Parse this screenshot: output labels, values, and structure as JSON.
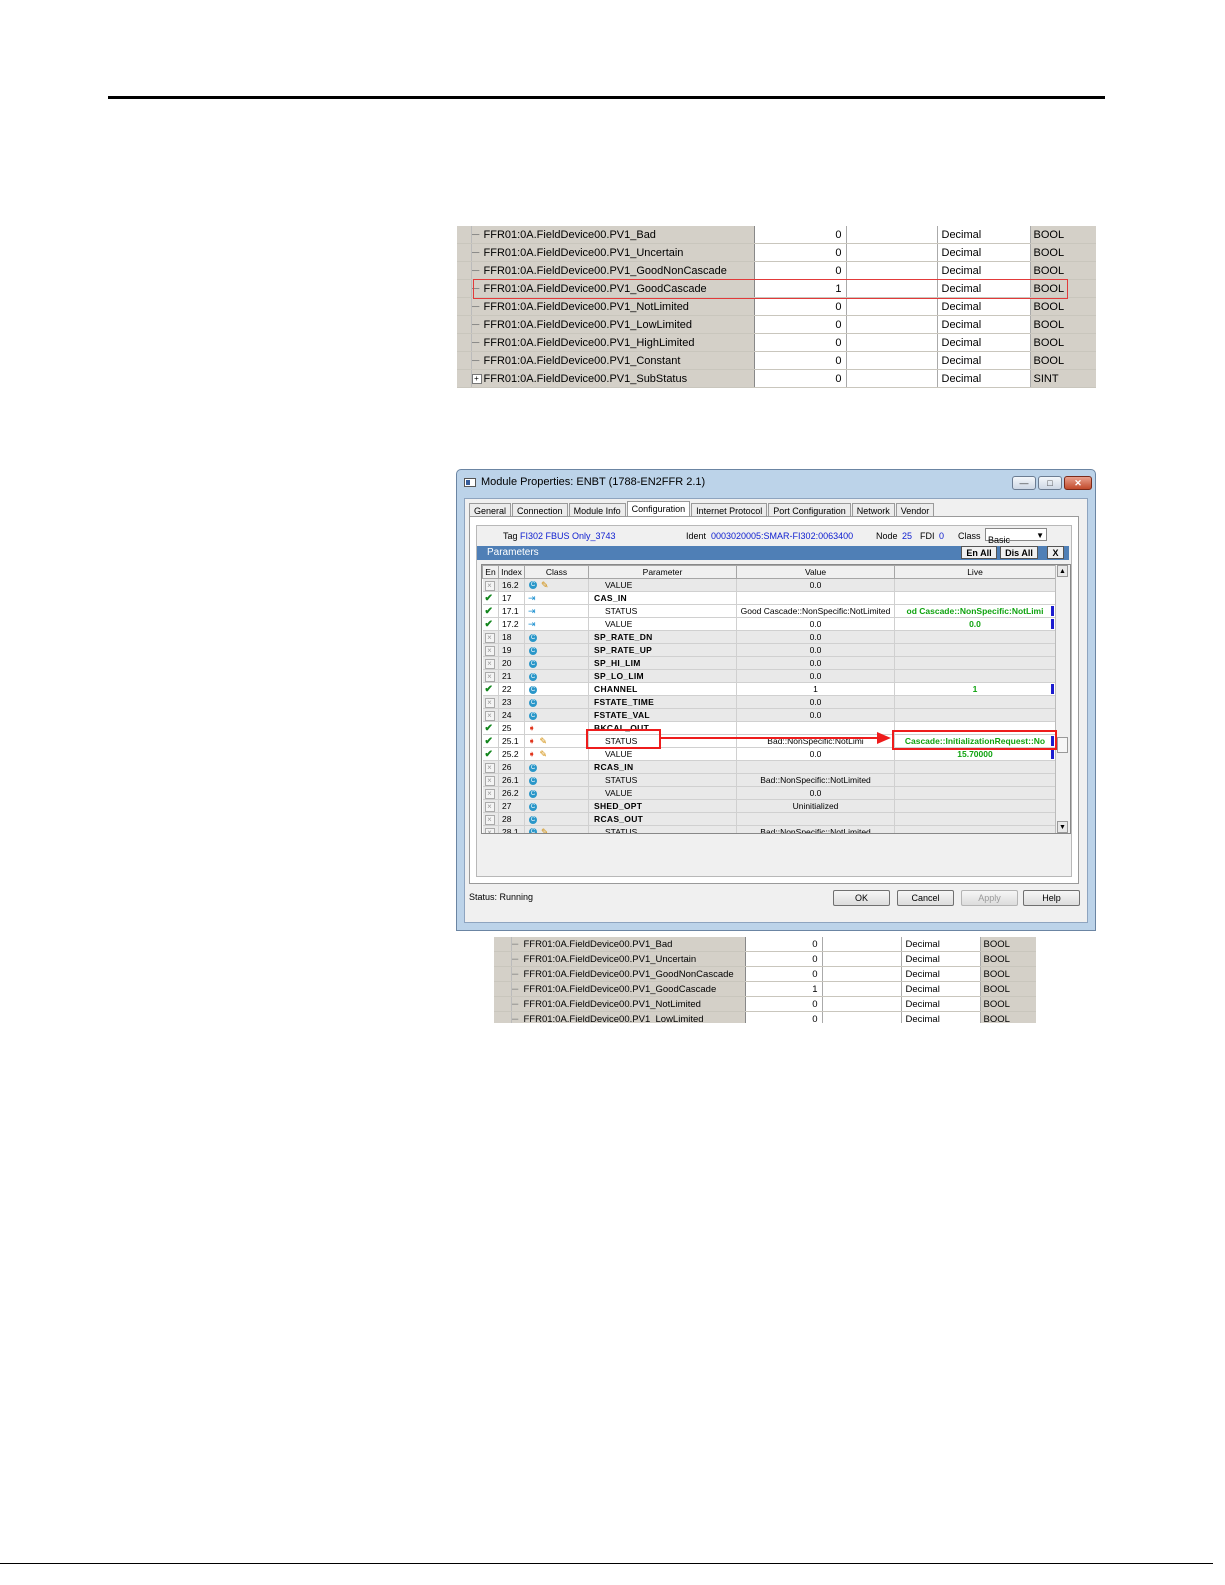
{
  "top_grid": {
    "rows": [
      {
        "name": "FFR01:0A.FieldDevice00.PV1_Bad",
        "value": "0",
        "style": "Decimal",
        "type": "BOOL",
        "expandable": false
      },
      {
        "name": "FFR01:0A.FieldDevice00.PV1_Uncertain",
        "value": "0",
        "style": "Decimal",
        "type": "BOOL",
        "expandable": false
      },
      {
        "name": "FFR01:0A.FieldDevice00.PV1_GoodNonCascade",
        "value": "0",
        "style": "Decimal",
        "type": "BOOL",
        "expandable": false
      },
      {
        "name": "FFR01:0A.FieldDevice00.PV1_GoodCascade",
        "value": "1",
        "style": "Decimal",
        "type": "BOOL",
        "expandable": false
      },
      {
        "name": "FFR01:0A.FieldDevice00.PV1_NotLimited",
        "value": "0",
        "style": "Decimal",
        "type": "BOOL",
        "expandable": false
      },
      {
        "name": "FFR01:0A.FieldDevice00.PV1_LowLimited",
        "value": "0",
        "style": "Decimal",
        "type": "BOOL",
        "expandable": false
      },
      {
        "name": "FFR01:0A.FieldDevice00.PV1_HighLimited",
        "value": "0",
        "style": "Decimal",
        "type": "BOOL",
        "expandable": false
      },
      {
        "name": "FFR01:0A.FieldDevice00.PV1_Constant",
        "value": "0",
        "style": "Decimal",
        "type": "BOOL",
        "expandable": false
      },
      {
        "name": "FFR01:0A.FieldDevice00.PV1_SubStatus",
        "value": "0",
        "style": "Decimal",
        "type": "SINT",
        "expandable": true
      }
    ]
  },
  "dialog": {
    "title": "Module Properties: ENBT (1788-EN2FFR 2.1)",
    "tabs": [
      "General",
      "Connection",
      "Module Info",
      "Configuration",
      "Internet Protocol",
      "Port Configuration",
      "Network",
      "Vendor"
    ],
    "active_tab": "Configuration",
    "info": {
      "tag_label": "Tag",
      "tag_value": "FI302 FBUS Only_3743",
      "ident_label": "Ident",
      "ident_value": "0003020005:SMAR-FI302:0063400",
      "node_label": "Node",
      "node_value": "25",
      "fdi_label": "FDI",
      "fdi_value": "0",
      "class_label": "Class",
      "class_value": "Basic"
    },
    "params_title": "Parameters",
    "en_all": "En All",
    "dis_all": "Dis All",
    "close_x": "X",
    "columns": [
      "En",
      "Index",
      "Class",
      "Parameter",
      "Value",
      "Live"
    ],
    "rows": [
      {
        "en": "x",
        "index": "16.2",
        "cls": "c",
        "pen": true,
        "param": "VALUE",
        "sub": true,
        "bold": false,
        "value": "0.0",
        "live": "",
        "mark": false
      },
      {
        "en": "check",
        "index": "17",
        "cls": "in",
        "pen": false,
        "param": "CAS_IN",
        "sub": false,
        "bold": true,
        "value": "",
        "live": "",
        "mark": false
      },
      {
        "en": "check",
        "index": "17.1",
        "cls": "in",
        "pen": false,
        "param": "STATUS",
        "sub": true,
        "bold": false,
        "value": "Good Cascade::NonSpecific:NotLimited",
        "live": "od Cascade::NonSpecific:NotLimi",
        "mark": true
      },
      {
        "en": "check",
        "index": "17.2",
        "cls": "in",
        "pen": false,
        "param": "VALUE",
        "sub": true,
        "bold": false,
        "value": "0.0",
        "live": "0.0",
        "mark": true
      },
      {
        "en": "x",
        "index": "18",
        "cls": "c",
        "pen": false,
        "param": "SP_RATE_DN",
        "sub": false,
        "bold": true,
        "value": "0.0",
        "live": "",
        "mark": false
      },
      {
        "en": "x",
        "index": "19",
        "cls": "c",
        "pen": false,
        "param": "SP_RATE_UP",
        "sub": false,
        "bold": true,
        "value": "0.0",
        "live": "",
        "mark": false
      },
      {
        "en": "x",
        "index": "20",
        "cls": "c",
        "pen": false,
        "param": "SP_HI_LIM",
        "sub": false,
        "bold": true,
        "value": "0.0",
        "live": "",
        "mark": false
      },
      {
        "en": "x",
        "index": "21",
        "cls": "c",
        "pen": false,
        "param": "SP_LO_LIM",
        "sub": false,
        "bold": true,
        "value": "0.0",
        "live": "",
        "mark": false
      },
      {
        "en": "check",
        "index": "22",
        "cls": "c",
        "pen": false,
        "param": "CHANNEL",
        "sub": false,
        "bold": true,
        "value": "1",
        "live": "1",
        "mark": true
      },
      {
        "en": "x",
        "index": "23",
        "cls": "c",
        "pen": false,
        "param": "FSTATE_TIME",
        "sub": false,
        "bold": true,
        "value": "0.0",
        "live": "",
        "mark": false
      },
      {
        "en": "x",
        "index": "24",
        "cls": "c",
        "pen": false,
        "param": "FSTATE_VAL",
        "sub": false,
        "bold": true,
        "value": "0.0",
        "live": "",
        "mark": false
      },
      {
        "en": "check",
        "index": "25",
        "cls": "out",
        "pen": false,
        "param": "BKCAL_OUT",
        "sub": false,
        "bold": true,
        "value": "",
        "live": "",
        "mark": false
      },
      {
        "en": "check",
        "index": "25.1",
        "cls": "out",
        "pen": true,
        "param": "STATUS",
        "sub": true,
        "bold": false,
        "value": "Bad::NonSpecific:NotLimi",
        "live": "Cascade::InitializationRequest::No",
        "mark": true
      },
      {
        "en": "check",
        "index": "25.2",
        "cls": "out",
        "pen": true,
        "param": "VALUE",
        "sub": true,
        "bold": false,
        "value": "0.0",
        "live": "15.70000",
        "mark": true
      },
      {
        "en": "x",
        "index": "26",
        "cls": "c",
        "pen": false,
        "param": "RCAS_IN",
        "sub": false,
        "bold": true,
        "value": "",
        "live": "",
        "mark": false
      },
      {
        "en": "x",
        "index": "26.1",
        "cls": "c",
        "pen": false,
        "param": "STATUS",
        "sub": true,
        "bold": false,
        "value": "Bad::NonSpecific::NotLimited",
        "live": "",
        "mark": false
      },
      {
        "en": "x",
        "index": "26.2",
        "cls": "c",
        "pen": false,
        "param": "VALUE",
        "sub": true,
        "bold": false,
        "value": "0.0",
        "live": "",
        "mark": false
      },
      {
        "en": "x",
        "index": "27",
        "cls": "c",
        "pen": false,
        "param": "SHED_OPT",
        "sub": false,
        "bold": true,
        "value": "Uninitialized",
        "live": "",
        "mark": false
      },
      {
        "en": "x",
        "index": "28",
        "cls": "c",
        "pen": false,
        "param": "RCAS_OUT",
        "sub": false,
        "bold": true,
        "value": "",
        "live": "",
        "mark": false
      },
      {
        "en": "x",
        "index": "28.1",
        "cls": "c",
        "pen": true,
        "param": "STATUS",
        "sub": true,
        "bold": false,
        "value": "Bad::NonSpecific::NotLimited",
        "live": "",
        "mark": false
      }
    ],
    "status_label": "Status:",
    "status_value": "Running",
    "buttons": {
      "ok": "OK",
      "cancel": "Cancel",
      "apply": "Apply",
      "help": "Help"
    }
  },
  "bottom_grid": {
    "rows": [
      {
        "name": "FFR01:0A.FieldDevice00.PV1_Bad",
        "value": "0",
        "style": "Decimal",
        "type": "BOOL"
      },
      {
        "name": "FFR01:0A.FieldDevice00.PV1_Uncertain",
        "value": "0",
        "style": "Decimal",
        "type": "BOOL"
      },
      {
        "name": "FFR01:0A.FieldDevice00.PV1_GoodNonCascade",
        "value": "0",
        "style": "Decimal",
        "type": "BOOL"
      },
      {
        "name": "FFR01:0A.FieldDevice00.PV1_GoodCascade",
        "value": "1",
        "style": "Decimal",
        "type": "BOOL"
      },
      {
        "name": "FFR01:0A.FieldDevice00.PV1_NotLimited",
        "value": "0",
        "style": "Decimal",
        "type": "BOOL"
      },
      {
        "name": "FFR01:0A.FieldDevice00.PV1_LowLimited",
        "value": "0",
        "style": "Decimal",
        "type": "BOOL"
      }
    ]
  },
  "colors": {
    "accent_blue": "#4f7fb6",
    "live_green": "#0fa30f",
    "highlight_red": "#ee1c1c"
  }
}
